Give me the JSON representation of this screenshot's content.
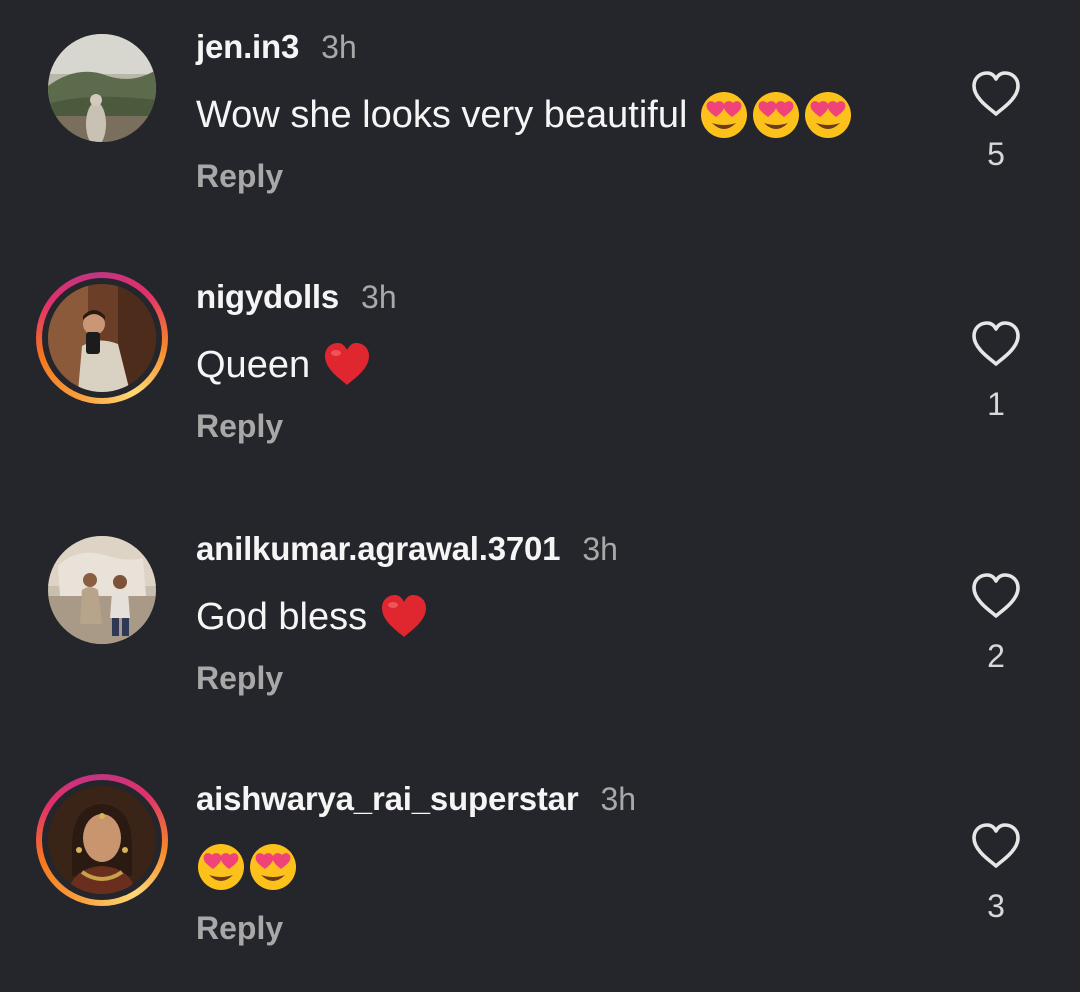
{
  "comments": [
    {
      "username": "jen.in3",
      "time": "3h",
      "text": "Wow she looks very beautiful",
      "emojis": [
        "heart-eyes-emoji",
        "heart-eyes-emoji",
        "heart-eyes-emoji"
      ],
      "reply_label": "Reply",
      "likes": "5",
      "has_story_ring": false
    },
    {
      "username": "nigydolls",
      "time": "3h",
      "text": "Queen",
      "emojis": [
        "red-heart-emoji"
      ],
      "reply_label": "Reply",
      "likes": "1",
      "has_story_ring": true
    },
    {
      "username": "anilkumar.agrawal.3701",
      "time": "3h",
      "text": "God bless",
      "emojis": [
        "red-heart-emoji"
      ],
      "reply_label": "Reply",
      "likes": "2",
      "has_story_ring": false
    },
    {
      "username": "aishwarya_rai_superstar",
      "time": "3h",
      "text": "",
      "emojis": [
        "heart-eyes-emoji",
        "heart-eyes-emoji"
      ],
      "reply_label": "Reply",
      "likes": "3",
      "has_story_ring": true
    }
  ],
  "icons": {
    "like": "heart-outline-icon"
  },
  "colors": {
    "background": "#25262b",
    "username": "#f5f5f5",
    "secondary_text": "#a8a8a8",
    "story_ring_start": "#f9a03f",
    "story_ring_end": "#c13584"
  }
}
